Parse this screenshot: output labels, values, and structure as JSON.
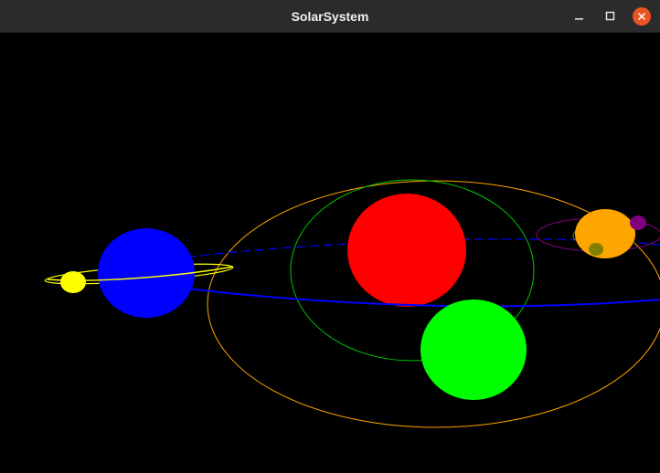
{
  "window": {
    "title": "SolarSystem",
    "controls": {
      "minimize_icon": "minimize-icon",
      "maximize_icon": "maximize-icon",
      "close_icon": "close-icon",
      "close_color": "#e95420"
    }
  },
  "scene": {
    "background": "#000000",
    "bodies": [
      {
        "name": "red-sphere",
        "color": "#ff0000"
      },
      {
        "name": "green-sphere",
        "color": "#00ff00"
      },
      {
        "name": "blue-sphere",
        "color": "#0000ff"
      },
      {
        "name": "yellow-sphere",
        "color": "#ffff00"
      },
      {
        "name": "orange-sphere",
        "color": "#ffa500"
      },
      {
        "name": "purple-sphere",
        "color": "#800080"
      },
      {
        "name": "olive-sphere",
        "color": "#808000"
      }
    ],
    "orbits": [
      {
        "name": "orange-orbit",
        "color": "#ffa500"
      },
      {
        "name": "green-orbit",
        "color": "#00c800"
      },
      {
        "name": "blue-orbit",
        "color": "#0000ff"
      },
      {
        "name": "yellow-orbit",
        "color": "#ffff00"
      },
      {
        "name": "purple-orbit",
        "color": "#800080"
      },
      {
        "name": "olive-orbit",
        "color": "#808000"
      }
    ]
  }
}
